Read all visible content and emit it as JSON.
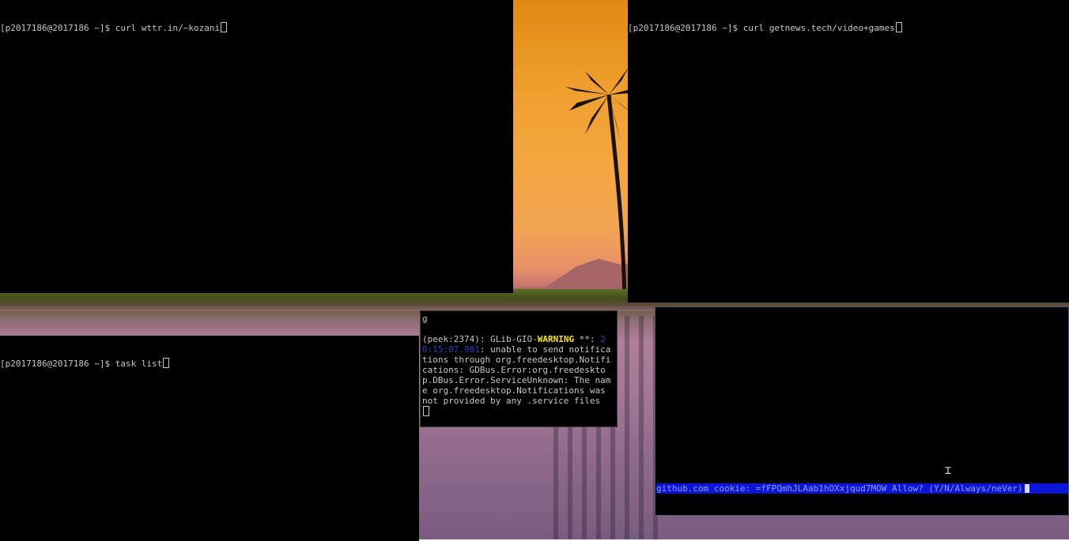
{
  "terminals": {
    "top_left": {
      "prompt": "[p2017186@2017186 ~]$ curl wttr.in/~kozani"
    },
    "top_right": {
      "prompt": "[p2017186@2017186 ~]$ curl getnews.tech/video+games"
    },
    "bottom_left": {
      "prompt": "[p2017186@2017186 ~]$ task list"
    },
    "popup": {
      "first_line": "g",
      "msg_prefix": "(peek:2374): GLib-GIO-",
      "warning": "WARNING",
      "msg_mid": " **: ",
      "timestamp": "20:15:07.981",
      "msg_rest": ": unable to send notifications through org.freedesktop.Notifications: GDBus.Error:org.freedesktop.DBus.Error.ServiceUnknown: The name org.freedesktop.Notifications was not provided by any .service files"
    },
    "bottom_right": {
      "prompt_text": "github.com cookie: =fFPQmhJLAab1hOXxjqud7MOW Allow? (Y/N/Always/neVer)"
    }
  },
  "colors": {
    "terminal_bg": "#000000",
    "warning": "#ffe800",
    "timestamp": "#2a3fd0",
    "prompt_highlight": "#0c14d8"
  },
  "icons": [
    "text-cursor-icon",
    "palm-tree-icon"
  ]
}
